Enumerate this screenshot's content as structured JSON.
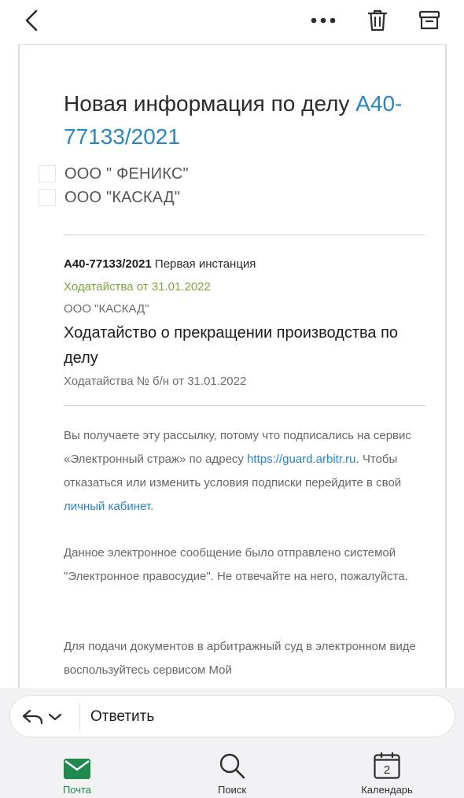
{
  "toolbar": {
    "back_icon": "chevron-left-icon",
    "more_icon": "more-horizontal-icon",
    "trash_icon": "trash-icon",
    "archive_icon": "archive-icon"
  },
  "message": {
    "subject_prefix": "Новая информация по делу ",
    "subject_case": "А40-77133/2021",
    "parties": [
      "ООО \" ФЕНИКС\"",
      "ООО \"КАСКАД\""
    ],
    "case_number": "А40-77133/2021",
    "instance": " Первая инстанция",
    "petition_date_line": "Ходатайства от 31.01.2022",
    "organization": "ООО \"КАСКАД\"",
    "document_title": "Ходатайство о прекращении производства по делу",
    "document_subtitle": "Ходатайства № б/н от 31.01.2022",
    "p1_text_a": "Вы получаете эту рассылку, потому что подписались на сервис «Электронный страж» по адресу ",
    "p1_link": "https://guard.arbitr.ru",
    "p1_text_b": ". Чтобы отказаться или изменить условия подписки перейдите в свой ",
    "p1_link2": "личный кабинет",
    "p1_text_c": ".",
    "p2_text": "Данное электронное сообщение было отправлено системой \"Электронное правосудие\". Не отвечайте на него, пожалуйста.",
    "p3_text": "Для подачи документов в арбитражный суд в электронном виде воспользуйтесь сервисом Мой"
  },
  "reply": {
    "label": "Ответить",
    "reply_icon": "reply-icon",
    "chevron_icon": "chevron-down-icon"
  },
  "tabs": {
    "mail": "Почта",
    "search": "Поиск",
    "calendar": "Календарь",
    "calendar_day": "2"
  },
  "colors": {
    "link": "#2a85c3",
    "green_status": "#7ba43a",
    "active_tab": "#1f8a4c"
  }
}
